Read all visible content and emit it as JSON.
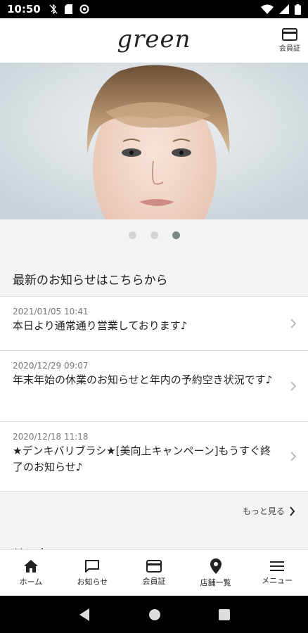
{
  "status_bar": {
    "time": "10:50"
  },
  "header": {
    "logo": "green",
    "member_card_label": "会員証"
  },
  "carousel": {
    "total": 3,
    "active_index": 2
  },
  "news": {
    "section_title": "最新のお知らせはこちらから",
    "items": [
      {
        "date": "2021/01/05 10:41",
        "title": "本日より通常通り営業しております♪"
      },
      {
        "date": "2020/12/29 09:07",
        "title": "年末年始の休業のお知らせと年内の予約空き状況です♪"
      },
      {
        "date": "2020/12/18 11:18",
        "title": "★デンキバリブラシ★[美向上キャンペーン]もうすぐ終了のお知らせ♪"
      }
    ],
    "more_label": "もっと見る"
  },
  "next_section_title": "リンク",
  "bottom_nav": {
    "items": [
      {
        "label": "ホーム",
        "icon": "home-icon"
      },
      {
        "label": "お知らせ",
        "icon": "chat-icon"
      },
      {
        "label": "会員証",
        "icon": "card-icon"
      },
      {
        "label": "店舗一覧",
        "icon": "location-pin-icon"
      },
      {
        "label": "メニュー",
        "icon": "menu-icon"
      }
    ]
  },
  "colors": {
    "accent_dot": "#7a8a84",
    "header_bg": "#ffffff",
    "page_bg": "#f4f4f4"
  }
}
